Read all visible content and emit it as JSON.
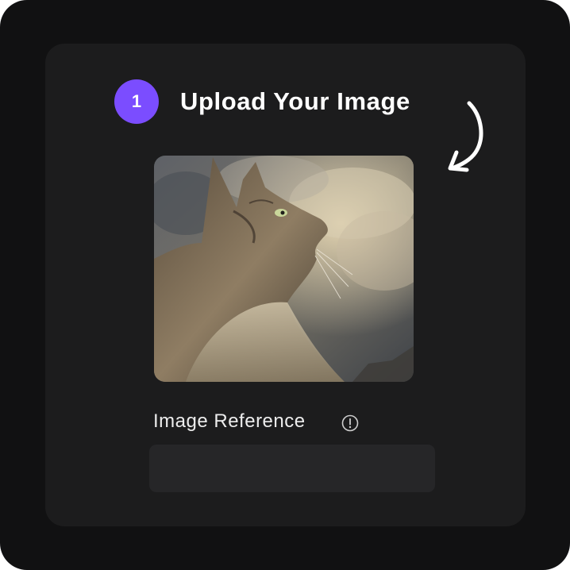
{
  "step": {
    "number": "1",
    "title": "Upload Your Image",
    "badge_color": "#7b4dff"
  },
  "arrow": {
    "icon": "curved-arrow-down-left-icon",
    "color": "#ffffff"
  },
  "upload": {
    "image_icon": "uploaded-cat-image",
    "image_subject": "cat"
  },
  "reference": {
    "label": "Image Reference",
    "info_icon": "info-circle-icon",
    "input_value": "",
    "placeholder": ""
  },
  "colors": {
    "page_background": "#111112",
    "card_background": "#1c1c1d",
    "input_background": "#262628",
    "text": "#ffffff"
  }
}
